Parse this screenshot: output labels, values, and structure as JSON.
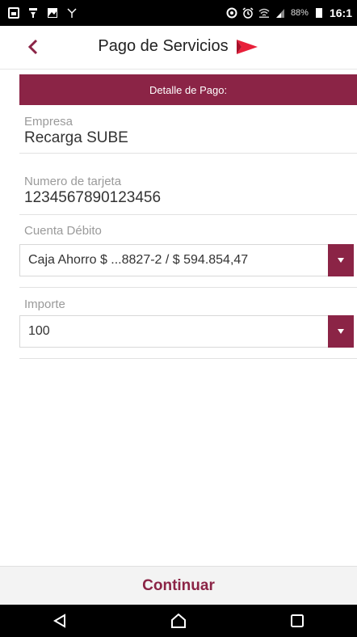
{
  "status_bar": {
    "battery_text": "88%",
    "time": "16:1"
  },
  "header": {
    "title": "Pago de Servicios",
    "back_icon": "chevron-left-icon",
    "logo_icon": "brand-arrow-icon"
  },
  "banner": {
    "label": "Detalle de Pago:"
  },
  "empresa": {
    "label": "Empresa",
    "value": "Recarga SUBE"
  },
  "tarjeta": {
    "label": "Numero de tarjeta",
    "value": "1234567890123456"
  },
  "cuenta": {
    "label": "Cuenta Débito",
    "selected": "Caja Ahorro $ ...8827-2 / $ 594.854,47"
  },
  "importe": {
    "label": "Importe",
    "selected": "100"
  },
  "continue_label": "Continuar",
  "colors": {
    "accent": "#8b2446",
    "logo_red": "#e8203a"
  }
}
